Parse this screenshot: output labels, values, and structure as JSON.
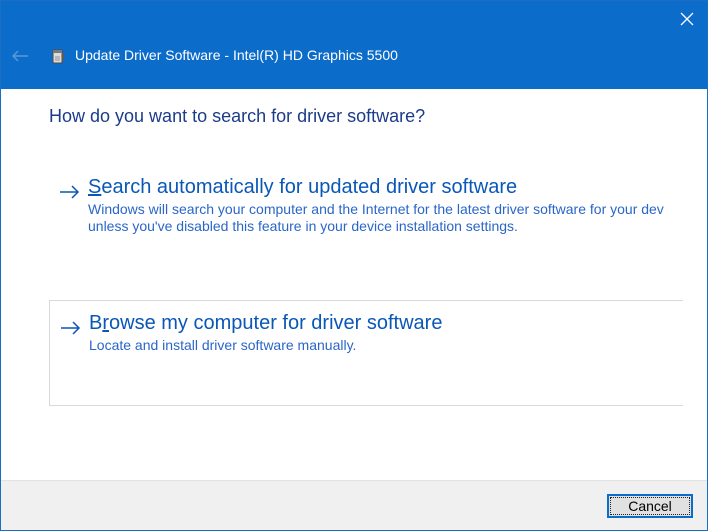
{
  "window": {
    "title": "Update Driver Software - Intel(R) HD Graphics 5500",
    "colors": {
      "titlebar": "#0b6cc9",
      "heading": "#1c3b8a",
      "link": "#0a57b8",
      "description": "#2a66c9"
    }
  },
  "icons": {
    "close": "close-icon",
    "back": "back-arrow-icon",
    "device": "device-driver-icon",
    "option_arrow": "arrow-right-icon"
  },
  "main": {
    "heading": "How do you want to search for driver software?",
    "options": [
      {
        "title_prefix": "",
        "title_accel": "S",
        "title_rest": "earch automatically for updated driver software",
        "description_line1": "Windows will search your computer and the Internet for the latest driver software for your dev",
        "description_line2": "unless you've disabled this feature in your device installation settings."
      },
      {
        "title_prefix": "B",
        "title_accel": "r",
        "title_rest": "owse my computer for driver software",
        "description_line1": "Locate and install driver software manually."
      }
    ]
  },
  "footer": {
    "cancel_label": "Cancel"
  }
}
